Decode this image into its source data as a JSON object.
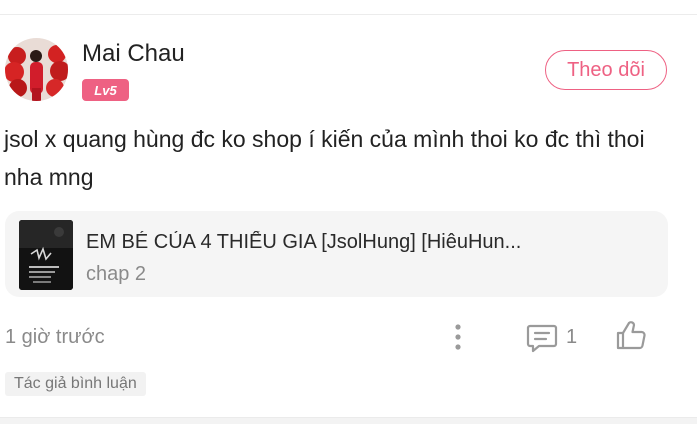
{
  "comment": {
    "user": {
      "name": "Mai Chau",
      "level": "Lv5",
      "avatar_icon": "user-avatar-photo"
    },
    "follow_label": "Theo dõi",
    "text": "jsol x quang hùng đc ko shop í kiến của mình thoi ko đc thì thoi nha mng",
    "story": {
      "title": "EM BÉ CỦA 4 THIẾU GIA [JsolHung] [HiêuHun...",
      "chapter": "chap 2",
      "cover_icon": "story-cover-thumbnail"
    },
    "time": "1 giờ trước",
    "reply_count": "1",
    "author_tag": "Tác giả bình luận"
  },
  "colors": {
    "accent": "#ee6183",
    "muted_text": "#8a8a8a",
    "card_bg": "#f5f5f5"
  }
}
